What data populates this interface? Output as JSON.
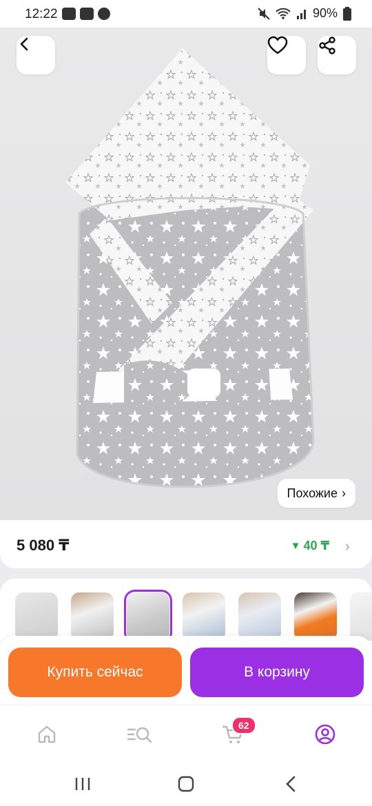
{
  "status_bar": {
    "time": "12:22",
    "battery": "90%"
  },
  "product": {
    "similar_label": "Похожие",
    "price": "5 080 ₸",
    "bonus": "40 ₸"
  },
  "thumbnails": {
    "count": 7,
    "selected_index": 2
  },
  "actions": {
    "buy_now": "Купить сейчас",
    "add_to_cart": "В корзину"
  },
  "bottom_nav": {
    "items": [
      "home-icon",
      "catalog-search-icon",
      "cart-icon",
      "profile-icon"
    ],
    "cart_badge": "62",
    "active": "profile-icon"
  },
  "colors": {
    "accent_purple": "#9b2fe3",
    "buy_orange": "#f7782a",
    "bonus_green": "#2aa653",
    "badge_pink": "#f0306a"
  }
}
